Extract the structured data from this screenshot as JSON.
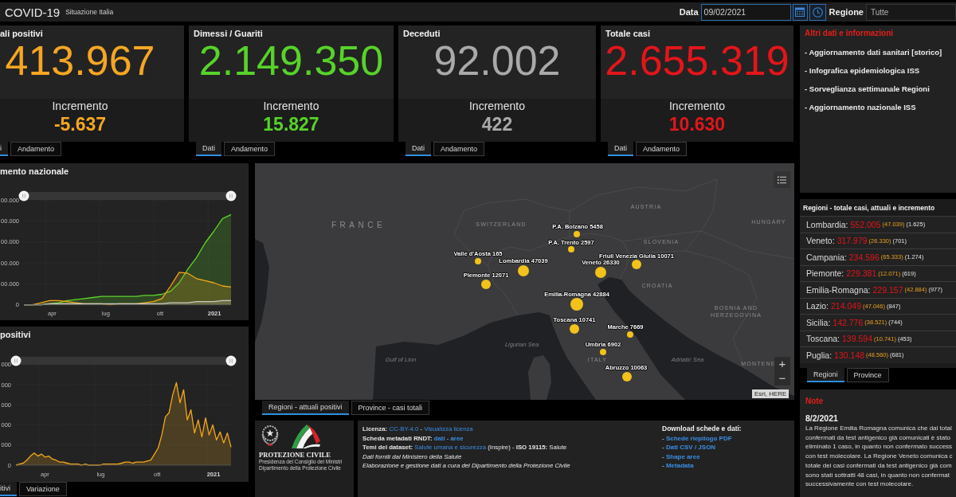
{
  "header": {
    "title": "COVID-19",
    "subtitle": "Situazione Italia",
    "date_label": "Data",
    "date": "09/02/2021",
    "region_label": "Regione",
    "region": "Tutte"
  },
  "cards": [
    {
      "title": "ali positivi",
      "value": "413.967",
      "increment_label": "Incremento",
      "increment": "-5.637",
      "color": "#f5a623",
      "tabs": [
        {
          "label": "i",
          "selected": true
        },
        {
          "label": "Andamento",
          "selected": false
        }
      ]
    },
    {
      "title": "Dimessi / Guariti",
      "value": "2.149.350",
      "increment_label": "Incremento",
      "increment": "15.827",
      "color": "#57d32a",
      "tabs": [
        {
          "label": "Dati",
          "selected": true
        },
        {
          "label": "Andamento",
          "selected": false
        }
      ]
    },
    {
      "title": "Deceduti",
      "value": "92.002",
      "increment_label": "Incremento",
      "increment": "422",
      "color": "#a9a9a9",
      "tabs": [
        {
          "label": "Dati",
          "selected": true
        },
        {
          "label": "Andamento",
          "selected": false
        }
      ]
    },
    {
      "title": "Totale casi",
      "value": "2.655.319",
      "increment_label": "Incremento",
      "increment": "10.630",
      "color": "#e3151a",
      "tabs": [
        {
          "label": "Dati",
          "selected": true
        },
        {
          "label": "Andamento",
          "selected": false
        }
      ]
    }
  ],
  "trend_chart": {
    "title": "mento nazionale",
    "y_axis_labels": [
      "00.000",
      "00.000",
      "00.000",
      "00.000",
      "00.000",
      "0"
    ],
    "x_axis_labels": [
      "apr",
      "lug",
      "ott",
      "2021"
    ]
  },
  "new_cases_chart": {
    "title": "positivi",
    "y_axis_labels": [
      "000",
      "000",
      "000",
      "000",
      "000",
      "0"
    ],
    "x_axis_labels": [
      "apr",
      "lug",
      "ott",
      "2021"
    ],
    "tabs": [
      {
        "label": "itivi",
        "selected": true
      },
      {
        "label": "Variazione",
        "selected": false
      }
    ]
  },
  "map": {
    "place_labels": [
      {
        "text": "FRANCE",
        "kind": "major"
      },
      {
        "text": "SWITZERLAND",
        "kind": "country"
      },
      {
        "text": "AUSTRIA",
        "kind": "country"
      },
      {
        "text": "HUNGARY",
        "kind": "country"
      },
      {
        "text": "SLOVENIA",
        "kind": "country"
      },
      {
        "text": "CROATIA",
        "kind": "country"
      },
      {
        "text": "BOSNIA AND HERZEGOVINA",
        "kind": "country"
      },
      {
        "text": "ITALY",
        "kind": "country"
      },
      {
        "text": "MONTENE",
        "kind": "country"
      },
      {
        "text": "Ligurian Sea",
        "kind": "sea"
      },
      {
        "text": "Gulf of Lion",
        "kind": "sea"
      },
      {
        "text": "Adriatic Sea",
        "kind": "sea"
      }
    ],
    "regions": [
      {
        "label": "P.A. Bolzano 5458"
      },
      {
        "label": "P.A. Trento 2597"
      },
      {
        "label": "Valle d'Aosta 165"
      },
      {
        "label": "Lombardia 47039"
      },
      {
        "label": "Friuli Venezia Giulia 10071"
      },
      {
        "label": "Veneto 26330"
      },
      {
        "label": "Piemonte 12071"
      },
      {
        "label": "Emilia-Romagna 42884"
      },
      {
        "label": "Toscana 10741"
      },
      {
        "label": "Marche 7669"
      },
      {
        "label": "Umbria 6902"
      },
      {
        "label": "Abruzzo 10063"
      }
    ],
    "zoom_in": "+",
    "zoom_out": "−",
    "attribution": "Esri, HERE",
    "tabs": [
      {
        "label": "Regioni - attuali positivi",
        "selected": true
      },
      {
        "label": "Province - casi totali",
        "selected": false
      }
    ]
  },
  "logo": {
    "title": "PROTEZIONE CIVILE",
    "lines": [
      "Presidenza del Consiglio dei Ministri",
      "Dipartimento della Protezione Civile"
    ]
  },
  "metadata": {
    "lines": [
      [
        {
          "kind": "label",
          "text": "Licenza:"
        },
        {
          "kind": "link",
          "text": "CC-BY-4.0"
        },
        {
          "kind": "plain",
          "text": "-"
        },
        {
          "kind": "link",
          "text": "Visualizza licenza"
        }
      ],
      [
        {
          "kind": "label",
          "text": "Scheda metadati RNDT:"
        },
        {
          "kind": "link_bold",
          "text": "dati"
        },
        {
          "kind": "plain",
          "text": "-"
        },
        {
          "kind": "link_bold",
          "text": "aree"
        }
      ],
      [
        {
          "kind": "label",
          "text": "Temi del dataset:"
        },
        {
          "kind": "link",
          "text": "Salute umana e sicurezza"
        },
        {
          "kind": "plain",
          "text": "(Inspire) -"
        },
        {
          "kind": "label",
          "text": "ISO 19115:"
        },
        {
          "kind": "plain",
          "text": "Salute"
        }
      ],
      [
        {
          "kind": "note",
          "text": "Dati forniti dal Ministero della Salute"
        }
      ],
      [
        {
          "kind": "note",
          "text": "Elaborazione e gestione dati a cura del Dipartimento della Protezione Civile"
        }
      ]
    ],
    "download": {
      "title": "Download schede e dati:",
      "links": [
        {
          "bullet": "-",
          "text": "Schede riepilogo PDF"
        },
        {
          "bullet": "-",
          "text": "Dati CSV / JSON"
        },
        {
          "bullet": "-",
          "text": "Shape aree"
        },
        {
          "bullet": "-",
          "text": "Metadata"
        }
      ]
    }
  },
  "info": {
    "title": "Altri dati e informazioni",
    "items": [
      "- Aggiornamento dati sanitari [storico]",
      "- Infografica epidemiologica ISS",
      "- Sorveglianza settimanale Regioni",
      "- Aggiornamento nazionale ISS"
    ]
  },
  "regions_list": {
    "title": "Regioni - totale casi, attuali e incremento",
    "rows": [
      {
        "name": "Lombardia:",
        "total": "552.005",
        "current": "(47.039)",
        "increment": "(1.625)"
      },
      {
        "name": "Veneto:",
        "total": "317.979",
        "current": "(26.330)",
        "increment": "(701)"
      },
      {
        "name": "Campania:",
        "total": "234.596",
        "current": "(65.333)",
        "increment": "(1.274)"
      },
      {
        "name": "Piemonte:",
        "total": "229.381",
        "current": "(12.071)",
        "increment": "(619)"
      },
      {
        "name": "Emilia-Romagna:",
        "total": "229.157",
        "current": "(42.884)",
        "increment": "(977)"
      },
      {
        "name": "Lazio:",
        "total": "214.049",
        "current": "(47.046)",
        "increment": "(847)"
      },
      {
        "name": "Sicilia:",
        "total": "142.776",
        "current": "(38.521)",
        "increment": "(744)"
      },
      {
        "name": "Toscana:",
        "total": "139.594",
        "current": "(10.741)",
        "increment": "(453)"
      },
      {
        "name": "Puglia:",
        "total": "130.148",
        "current": "(48.560)",
        "increment": "(681)"
      }
    ],
    "tabs": [
      {
        "label": "Regioni",
        "selected": true
      },
      {
        "label": "Province",
        "selected": false
      }
    ]
  },
  "note": {
    "title": "Note",
    "date": "8/2/2021",
    "lines": [
      "La Regione Emilia Romagna comunica che dal total",
      "confermati da test antigenico già comunicati è stato",
      "eliminato 1 caso, in quanto non confermato success",
      "con test molecolare. La Regione Veneto comunica c",
      "totale dei casi confermati da test antigenico già com",
      "sono stati sottratti 48 casi, in quanto non confermat",
      "successivamente con test molecolare."
    ]
  }
}
